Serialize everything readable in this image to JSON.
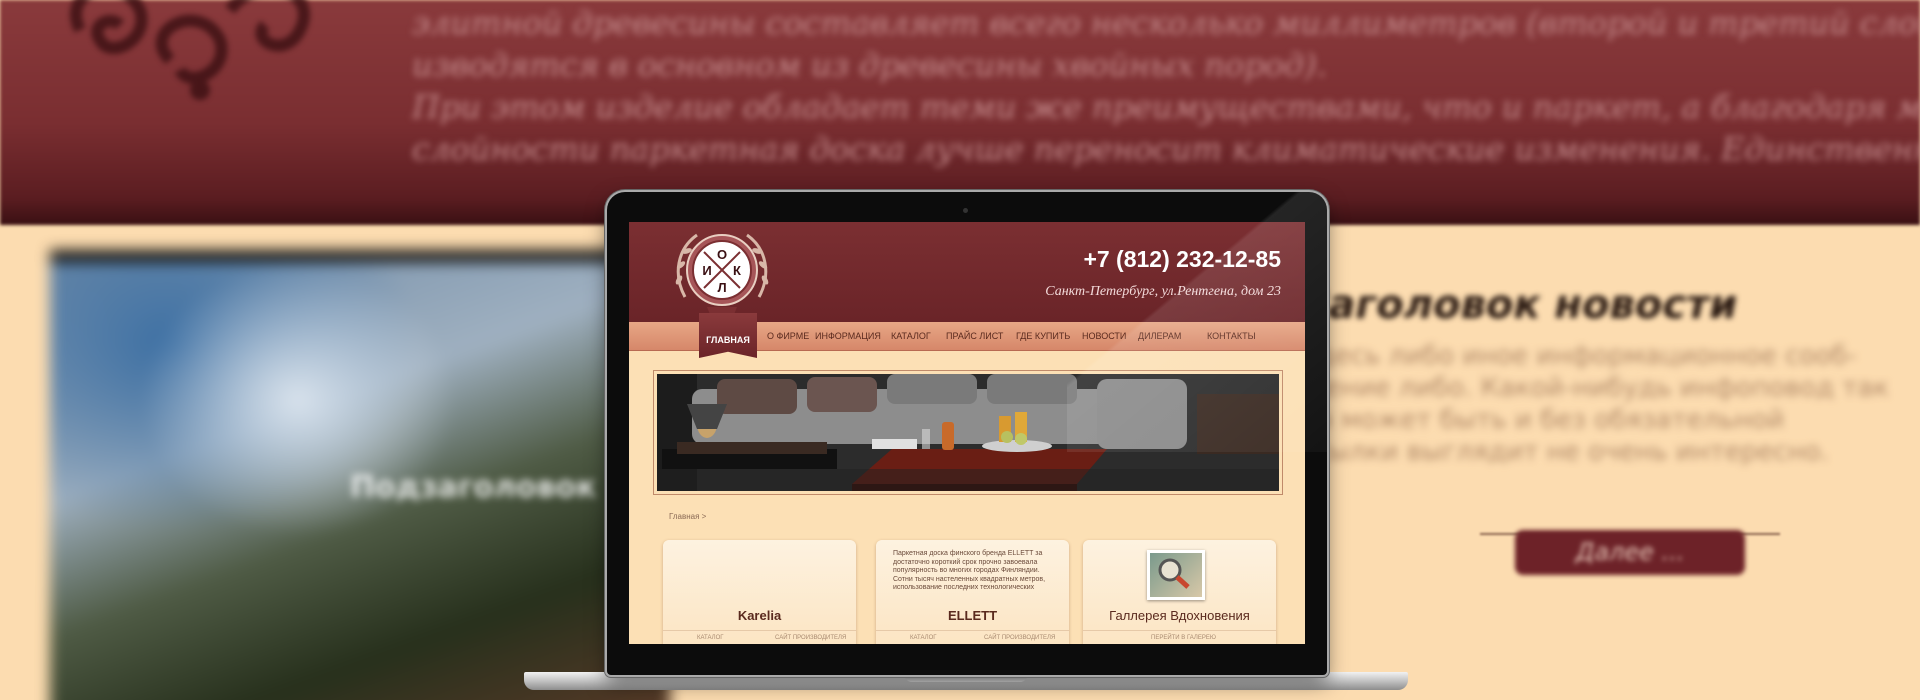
{
  "background": {
    "paragraph_lines": [
      "элитной древесины составляет всего несколько миллиметров (второй и третий слой про-",
      "изводятся в основном из древесины хвойных пород).",
      "При этом изделие обладает теми же преимуществами, что и паркет, а благодаря много-",
      "слойности паркетная доска лучше переносит климатические изменения. Единственным"
    ],
    "photo_caption": "Подзаголовок",
    "news_title": "Заголовок новости",
    "news_lines": [
      "Здесь либо иное информационное сооб-",
      "щение либо. Какой-нибудь инфоповод так",
      "он может быть и без обязательной",
      "ссылки выглядит не очень интересно."
    ],
    "more_button": "Далее ..."
  },
  "site": {
    "logo_letters": [
      "О",
      "И",
      "К",
      "Л"
    ],
    "phone": "+7 (812) 232-12-85",
    "address": "Санкт-Петербург, ул.Рентгена, дом 23",
    "nav": [
      {
        "label": "ГЛАВНАЯ",
        "active": true
      },
      {
        "label": "О ФИРМЕ"
      },
      {
        "label": "ИНФОРМАЦИЯ"
      },
      {
        "label": "КАТАЛОГ"
      },
      {
        "label": "ПРАЙС ЛИСТ"
      },
      {
        "label": "ГДЕ КУПИТЬ"
      },
      {
        "label": "НОВОСТИ"
      },
      {
        "label": "ДИЛЕРАМ"
      },
      {
        "label": "КОНТАКТЫ"
      }
    ],
    "breadcrumb": "Главная   >",
    "cards": [
      {
        "title": "Karelia",
        "links": [
          "КАТАЛОГ",
          "САЙТ ПРОИЗВОДИТЕЛЯ"
        ]
      },
      {
        "title": "ELLETT",
        "text": "Паркетная доска финского бренда ELLETT за достаточно короткий срок прочно завоевала популярность во многих городах Финляндии. Сотни тысяч настеленных квадратных метров, использование последних технологических",
        "links": [
          "КАТАЛОГ",
          "САЙТ ПРОИЗВОДИТЕЛЯ"
        ]
      },
      {
        "title": "Галлерея Вдохновения",
        "links": [
          "ПЕРЕЙТИ В ГАЛЕРЕЮ"
        ]
      }
    ]
  },
  "colors": {
    "header_bg": "#7b2f32",
    "page_bg": "#fcdcb0",
    "nav_bg": "#e7a786",
    "accent_dark": "#6d2228"
  }
}
